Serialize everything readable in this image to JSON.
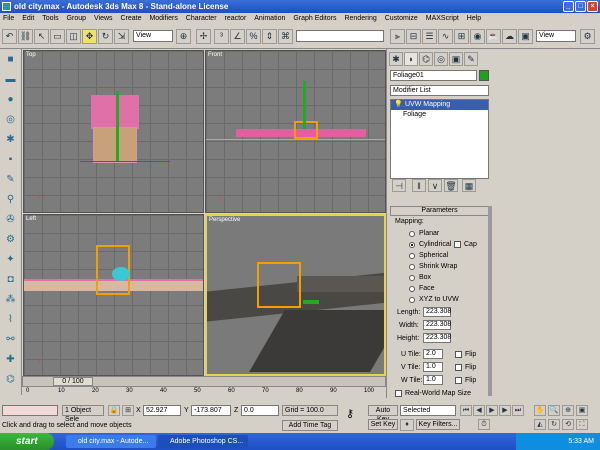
{
  "window": {
    "title": "old city.max - Autodesk 3ds Max 8  - Stand-alone License"
  },
  "menu": [
    "File",
    "Edit",
    "Tools",
    "Group",
    "Views",
    "Create",
    "Modifiers",
    "Character",
    "reactor",
    "Animation",
    "Graph Editors",
    "Rendering",
    "Customize",
    "MAXScript",
    "Help"
  ],
  "toolbar": {
    "view_select": "View",
    "view_select2": "View"
  },
  "viewports": {
    "top": "Top",
    "front": "Front",
    "left": "Left",
    "perspective": "Perspective"
  },
  "command_panel": {
    "object_name": "Foliage01",
    "object_color": "#20a020",
    "modifier_list": "Modifier List",
    "stack": [
      "UVW Mapping",
      "Foliage"
    ],
    "rollout_title": "Parameters",
    "mapping_label": "Mapping:",
    "mapping_options": [
      "Planar",
      "Cylindrical",
      "Spherical",
      "Shrink Wrap",
      "Box",
      "Face",
      "XYZ to UVW"
    ],
    "selected_mapping": "Cylindrical",
    "cap_label": "Cap",
    "length_label": "Length:",
    "length_value": "223.308",
    "width_label": "Width:",
    "width_value": "223.308",
    "height_label": "Height:",
    "height_value": "223.308",
    "utile_label": "U Tile:",
    "utile_value": "2.0",
    "vtile_label": "V Tile:",
    "vtile_value": "1.0",
    "wtile_label": "W Tile:",
    "wtile_value": "1.0",
    "flip_label": "Flip",
    "realworld_label": "Real-World Map Size"
  },
  "timeline": {
    "frame": "0 / 100",
    "ticks": [
      "0",
      "10",
      "20",
      "30",
      "40",
      "50",
      "60",
      "70",
      "80",
      "90",
      "100"
    ]
  },
  "status": {
    "selection": "1 Object Sele",
    "prompt": "Click and drag to select and move objects",
    "x_label": "X",
    "x_value": "52.927",
    "y_label": "Y",
    "y_value": "-173.807",
    "z_label": "Z",
    "z_value": "0.0",
    "grid": "Grid = 100.0",
    "add_time_tag": "Add Time Tag",
    "auto_key": "Auto Key",
    "set_key": "Set Key",
    "selected": "Selected",
    "key_filters": "Key Filters..."
  },
  "taskbar": {
    "start": "start",
    "tasks": [
      "old city.max - Autode...",
      "Adobe Photoshop CS..."
    ],
    "clock": "5:33 AM"
  }
}
